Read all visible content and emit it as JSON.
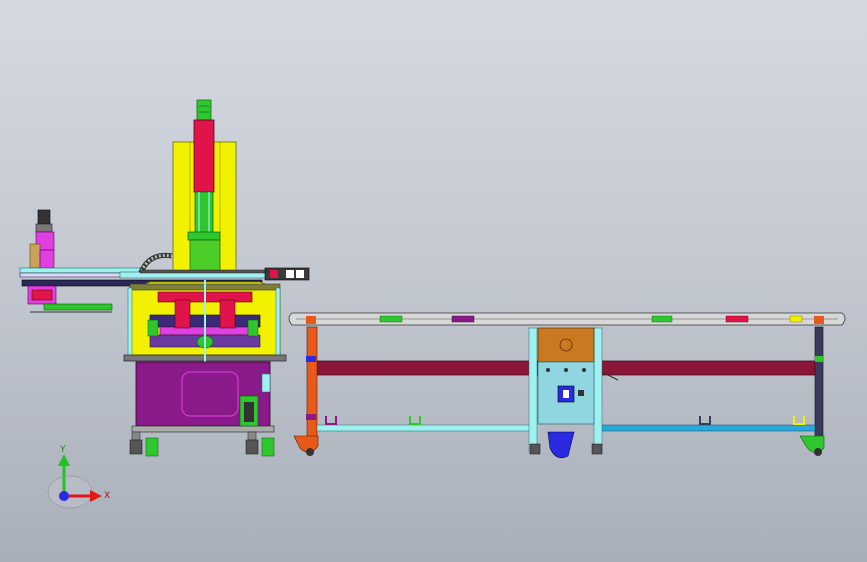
{
  "viewport": {
    "background_top": "#d4d9e2",
    "background_bottom": "#a9afb9"
  },
  "triad": {
    "y_label": "Y",
    "x_label": "X",
    "y_color": "#21c421",
    "x_color": "#e01818",
    "z_color": "#2a2ae0"
  },
  "colors": {
    "press_column": "#f2f200",
    "cylinder": "#e0144a",
    "cabinet": "#8a1a8a",
    "conveyor_rail": "#8a1538",
    "control_box_top": "#c97a20",
    "control_box_bottom": "#8fd6e0",
    "frame_outline": "#3a3a3a",
    "green_part": "#2ec82e",
    "cyan_rod": "#9ff0f0",
    "blue_bar": "#2aa8d8",
    "orange_leg": "#e85a1a",
    "magenta_part": "#e040e0"
  }
}
